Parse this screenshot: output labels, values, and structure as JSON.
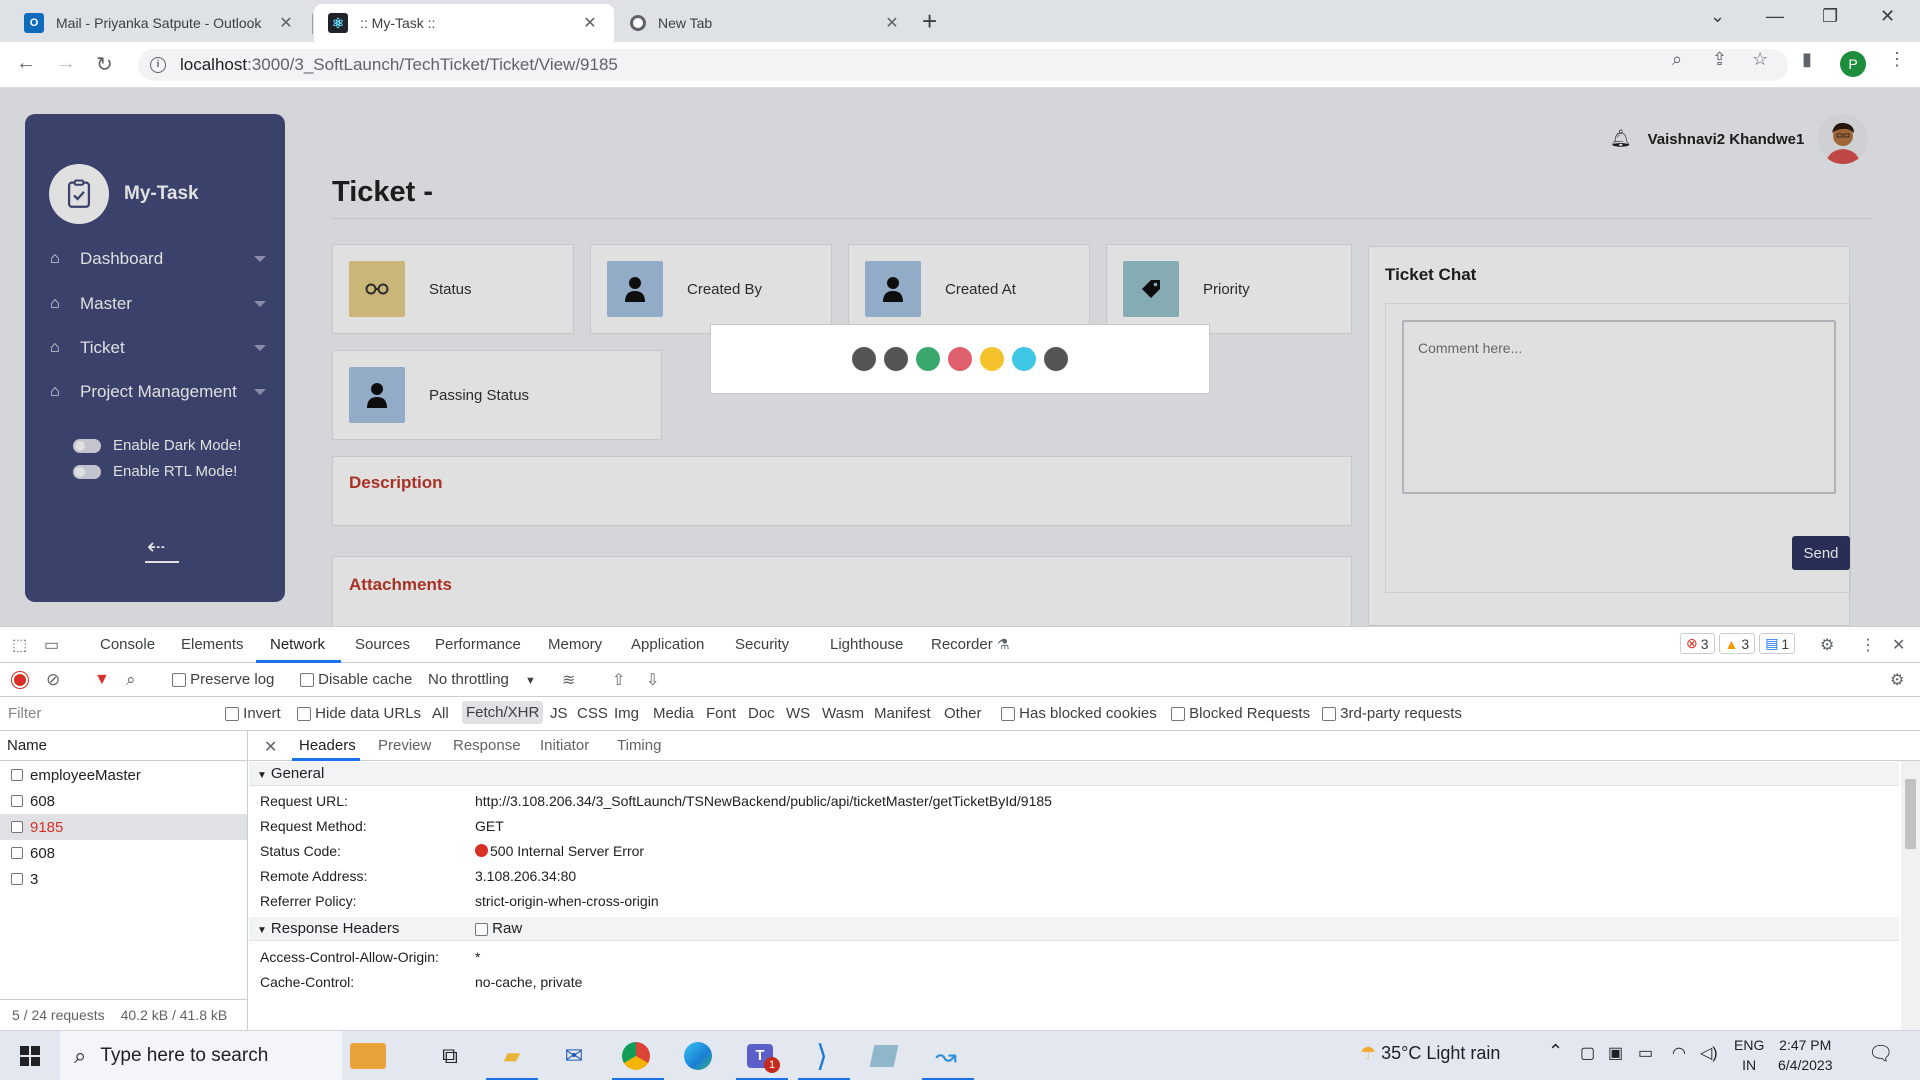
{
  "browser": {
    "tabs": [
      {
        "title": "Mail - Priyanka Satpute - Outlook",
        "icon": "outlook-icon"
      },
      {
        "title": ":: My-Task ::",
        "icon": "react-icon",
        "active": true
      },
      {
        "title": "New Tab",
        "icon": "chrome-icon"
      }
    ],
    "url_host": "localhost",
    "url_path": ":3000/3_SoftLaunch/TechTicket/Ticket/View/9185",
    "profile_initial": "P"
  },
  "app": {
    "logo_title": "My-Task",
    "nav": [
      "Dashboard",
      "Master",
      "Ticket",
      "Project Management"
    ],
    "toggles": [
      "Enable Dark Mode!",
      "Enable RTL Mode!"
    ],
    "user_name": "Vaishnavi2 Khandwe1",
    "page_title": "Ticket -",
    "cards": [
      "Status",
      "Created By",
      "Created At",
      "Priority",
      "Passing Status"
    ],
    "description_title": "Description",
    "attachments_title": "Attachments",
    "chat_title": "Ticket Chat",
    "comment_placeholder": "Comment here...",
    "send_label": "Send",
    "loader_colors": [
      "#555555",
      "#555555",
      "#3aa76d",
      "#e05f6d",
      "#f4c22b",
      "#41c7e6",
      "#555555"
    ]
  },
  "devtools": {
    "tabs": [
      "Console",
      "Elements",
      "Network",
      "Sources",
      "Performance",
      "Memory",
      "Application",
      "Security",
      "Lighthouse",
      "Recorder"
    ],
    "active_tab": "Network",
    "errors": "3",
    "warnings": "3",
    "messages": "1",
    "preserve_log": "Preserve log",
    "disable_cache": "Disable cache",
    "throttling": "No throttling",
    "filter_placeholder": "Filter",
    "invert": "Invert",
    "hide_data_urls": "Hide data URLs",
    "type_filters": [
      "All",
      "Fetch/XHR",
      "JS",
      "CSS",
      "Img",
      "Media",
      "Font",
      "Doc",
      "WS",
      "Wasm",
      "Manifest",
      "Other"
    ],
    "has_blocked_cookies": "Has blocked cookies",
    "blocked_requests": "Blocked Requests",
    "third_party": "3rd-party requests",
    "name_header": "Name",
    "requests": [
      "employeeMaster",
      "608",
      "9185",
      "608",
      "3"
    ],
    "summary_requests": "5 / 24 requests",
    "summary_size": "40.2 kB / 41.8 kB",
    "detail_tabs": [
      "Headers",
      "Preview",
      "Response",
      "Initiator",
      "Timing"
    ],
    "general_title": "General",
    "general": [
      {
        "k": "Request URL:",
        "v": "http://3.108.206.34/3_SoftLaunch/TSNewBackend/public/api/ticketMaster/getTicketById/9185"
      },
      {
        "k": "Request Method:",
        "v": "GET"
      },
      {
        "k": "Status Code:",
        "v": "500 Internal Server Error"
      },
      {
        "k": "Remote Address:",
        "v": "3.108.206.34:80"
      },
      {
        "k": "Referrer Policy:",
        "v": "strict-origin-when-cross-origin"
      }
    ],
    "response_headers_title": "Response Headers",
    "raw_label": "Raw",
    "response_headers": [
      {
        "k": "Access-Control-Allow-Origin:",
        "v": "*"
      },
      {
        "k": "Cache-Control:",
        "v": "no-cache, private"
      }
    ]
  },
  "taskbar": {
    "search_placeholder": "Type here to search",
    "weather": "35°C  Light rain",
    "lang": "ENG",
    "region": "IN",
    "time": "2:47 PM",
    "date": "6/4/2023",
    "teams_badge": "1"
  }
}
